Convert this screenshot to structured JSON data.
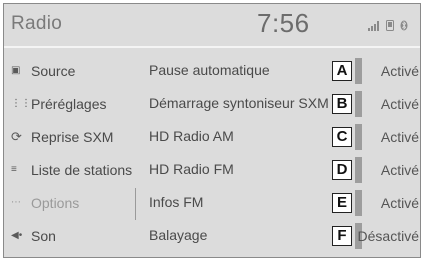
{
  "header": {
    "title": "Radio",
    "clock": "7:56",
    "status_icons": [
      "signal-icon",
      "phone-icon",
      "bluetooth-icon"
    ]
  },
  "sidebar": {
    "items": [
      {
        "label": "Source",
        "icon": "source-icon"
      },
      {
        "label": "Préréglages",
        "icon": "presets-icon"
      },
      {
        "label": "Reprise SXM",
        "icon": "replay-icon"
      },
      {
        "label": "Liste de stations",
        "icon": "station-list-icon"
      },
      {
        "label": "Options",
        "icon": "options-icon",
        "active": true
      },
      {
        "label": "Son",
        "icon": "sound-icon"
      }
    ]
  },
  "options": [
    {
      "label": "Pause automatique",
      "letter": "A",
      "value": "Activé"
    },
    {
      "label": "Démarrage syntoniseur SXM",
      "letter": "B",
      "value": "Activé"
    },
    {
      "label": "HD Radio AM",
      "letter": "C",
      "value": "Activé"
    },
    {
      "label": "HD Radio FM",
      "letter": "D",
      "value": "Activé"
    },
    {
      "label": "Infos FM",
      "letter": "E",
      "value": "Activé"
    },
    {
      "label": "Balayage",
      "letter": "F",
      "value": "Désactivé"
    }
  ]
}
